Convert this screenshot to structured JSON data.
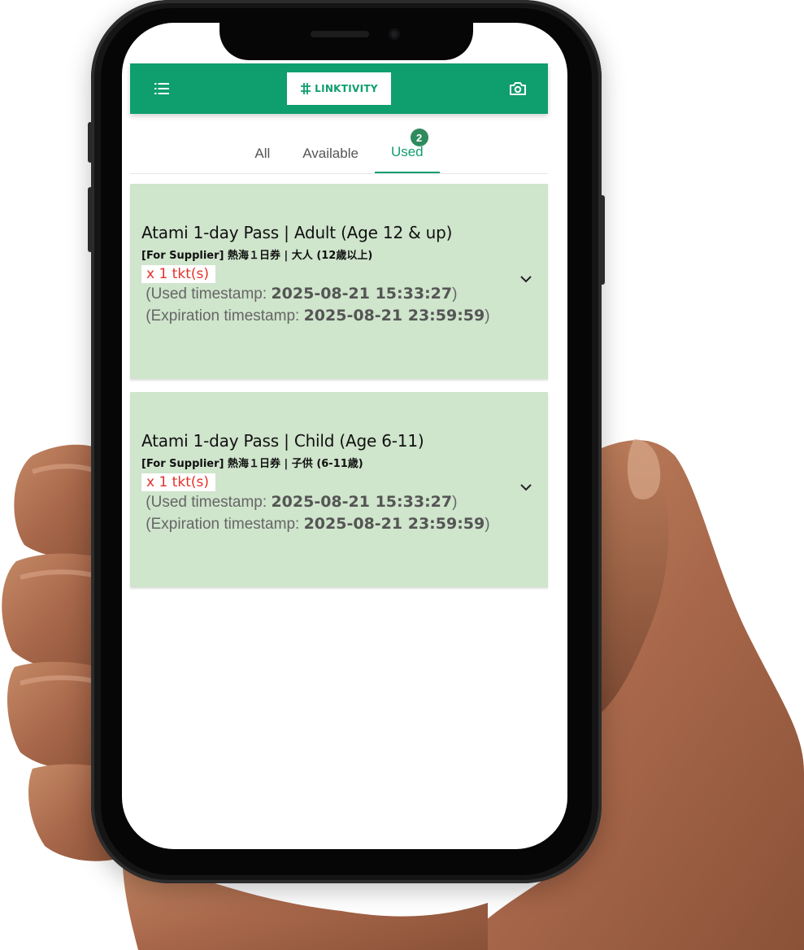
{
  "app": {
    "logo_text": "LINKTIVITY",
    "menu_icon": "menu-icon",
    "camera_icon": "camera-icon",
    "accent_color": "#0f9e6e"
  },
  "tabs": [
    {
      "label": "All",
      "active": false
    },
    {
      "label": "Available",
      "active": false
    },
    {
      "label": "Used",
      "active": true,
      "badge": "2"
    }
  ],
  "tickets": [
    {
      "title": "Atami 1-day Pass | Adult (Age 12 & up)",
      "subtitle": "[For Supplier] 熱海１日券 | 大人 (12歳以上)",
      "quantity": "x 1 tkt(s)",
      "used_label": "(Used timestamp: ",
      "used_value": "2025-08-21 15:33:27",
      "expiration_label": "(Expiration timestamp: ",
      "expiration_value": "2025-08-21 23:59:59",
      "close_paren": ")"
    },
    {
      "title": "Atami 1-day Pass | Child (Age 6-11)",
      "subtitle": "[For Supplier] 熱海１日券 | 子供 (6-11歳)",
      "quantity": "x 1 tkt(s)",
      "used_label": "(Used timestamp: ",
      "used_value": "2025-08-21 15:33:27",
      "expiration_label": "(Expiration timestamp: ",
      "expiration_value": "2025-08-21 23:59:59",
      "close_paren": ")"
    }
  ]
}
